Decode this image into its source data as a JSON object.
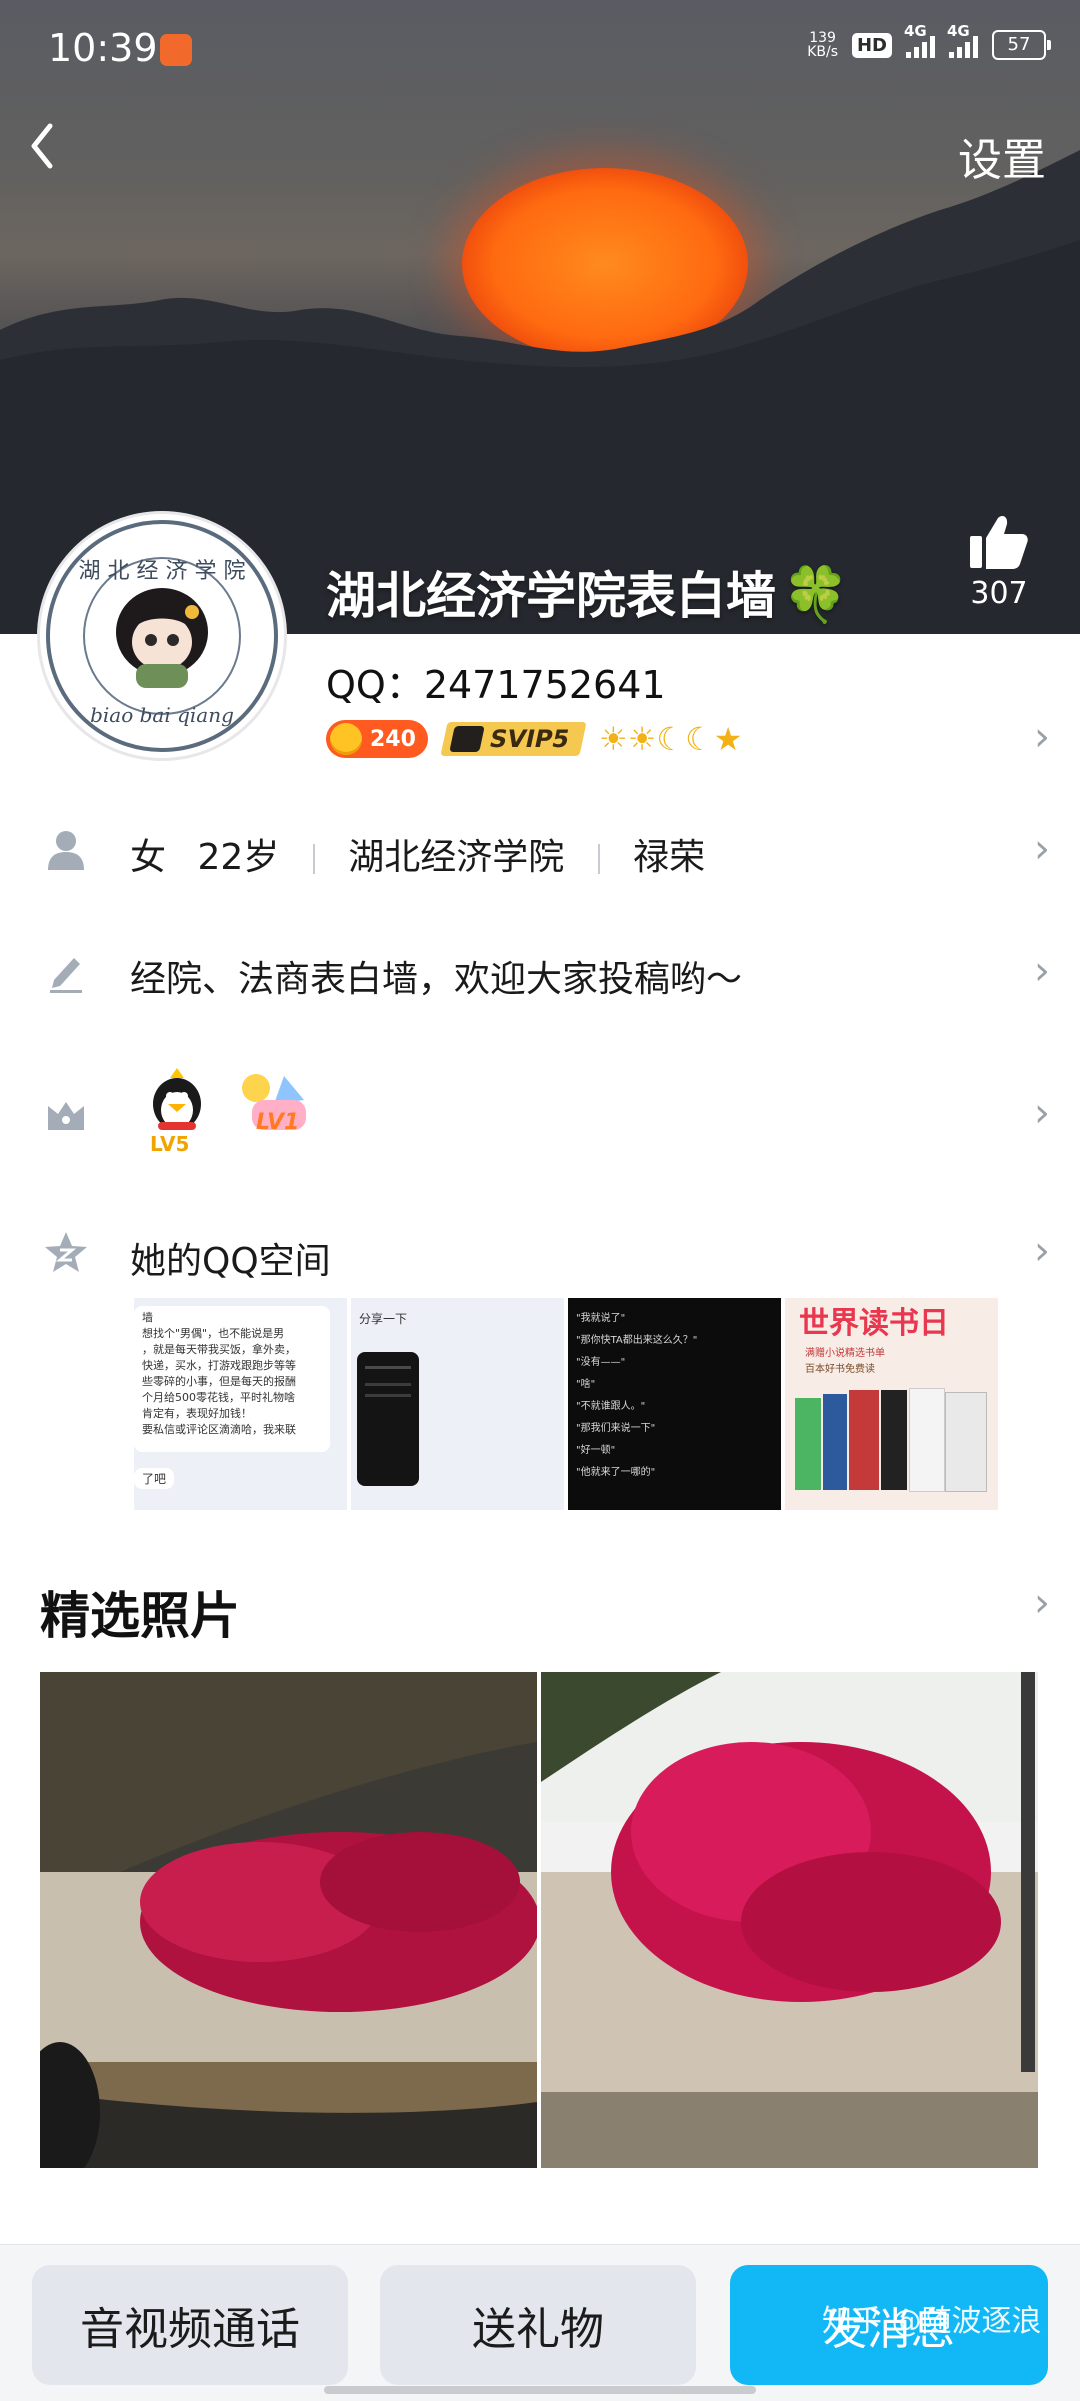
{
  "status_bar": {
    "time": "10:39",
    "app_badge": "应用\n通知",
    "net_speed": "139\nKB/s",
    "hd_label": "HD",
    "sim1_label": "4G",
    "sim2_label": "4G",
    "battery": "57"
  },
  "header": {
    "back_icon": "chevron-left-icon",
    "settings_label": "设置",
    "name": "湖北经济学院表白墙",
    "name_emoji": "🍀",
    "like_count": "307"
  },
  "profile": {
    "qq_label": "QQ：2471752641",
    "coin_badge": "240",
    "svip_badge": "SVIP5",
    "level_icons": "☀☀☾☾★",
    "avatar_ring_text": "湖北经济学院表白墙",
    "avatar_sub_text": "biao bai qiang"
  },
  "rows": {
    "basic": {
      "gender": "女",
      "age": "22岁",
      "school": "湖北经济学院",
      "place": "禄荣"
    },
    "signature": "经院、法商表白墙，欢迎大家投稿哟～",
    "badges": {
      "penguin_level": "LV5",
      "other_level": "LV1"
    },
    "qzone_label": "她的QQ空间"
  },
  "qzone_thumbs": [
    {
      "lines": [
        "墙",
        "想找个\"男偶\"，也不能说是男",
        "，就是每天带我买饭，拿外卖，",
        "快递，买水，打游戏跟跑步等等",
        "些零碎的小事，但是每天的报酬",
        "个月给500零花钱，平时礼物啥",
        "肯定有，表现好加钱！",
        "要私信或评论区滴滴哈，我来联",
        "了吧"
      ]
    },
    {
      "share_label": "分享一下"
    },
    {
      "lines": [
        "\"我就说了\"",
        "\"那你快TA都出来这么久？\"",
        "\"没有——\"",
        "\"啥\"",
        "\"不就谁跟人。\"",
        "\"那我们来说一下\"",
        "\"好一顿\"",
        "\"他就来了一哪的\""
      ]
    },
    {
      "title": "世界读书日",
      "lines": [
        "满赠小说精选书单",
        "百本好书免费读"
      ]
    }
  ],
  "featured": {
    "title": "精选照片"
  },
  "bottom": {
    "call_label": "音视频通话",
    "gift_label": "送礼物",
    "message_label": "发消息",
    "watermark": "知乎 @随波逐浪"
  }
}
